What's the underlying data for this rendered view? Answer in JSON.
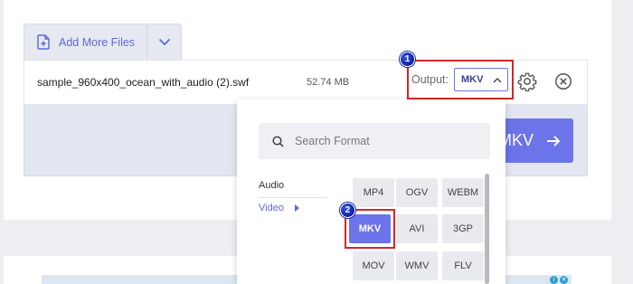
{
  "toolbar": {
    "add_more_label": "Add More Files",
    "add_icon": "file-plus-icon",
    "chevron_icon": "chevron-down-icon"
  },
  "file": {
    "name": "sample_960x400_ocean_with_audio (2).swf",
    "size": "52.74 MB"
  },
  "output": {
    "label": "Output:",
    "value": "MKV",
    "chevron_icon": "chevron-up-icon"
  },
  "annotations": {
    "badge_1": "1",
    "badge_2": "2",
    "highlight_color": "#d4252b",
    "badge_color": "#0b1f9c"
  },
  "actions": {
    "settings_icon": "gear-icon",
    "remove_icon": "close-circle-icon"
  },
  "convert": {
    "label": "MKV",
    "icon": "arrow-right-icon",
    "color": "#6b74e8"
  },
  "format_dropdown": {
    "search_placeholder": "Search Format",
    "search_icon": "search-icon",
    "categories": [
      {
        "label": "Audio",
        "active": false
      },
      {
        "label": "Video",
        "active": true
      }
    ],
    "formats": [
      {
        "label": "MP4",
        "selected": false
      },
      {
        "label": "OGV",
        "selected": false
      },
      {
        "label": "WEBM",
        "selected": false
      },
      {
        "label": "MKV",
        "selected": true
      },
      {
        "label": "AVI",
        "selected": false
      },
      {
        "label": "3GP",
        "selected": false
      },
      {
        "label": "MOV",
        "selected": false
      },
      {
        "label": "WMV",
        "selected": false
      },
      {
        "label": "FLV",
        "selected": false
      }
    ]
  }
}
